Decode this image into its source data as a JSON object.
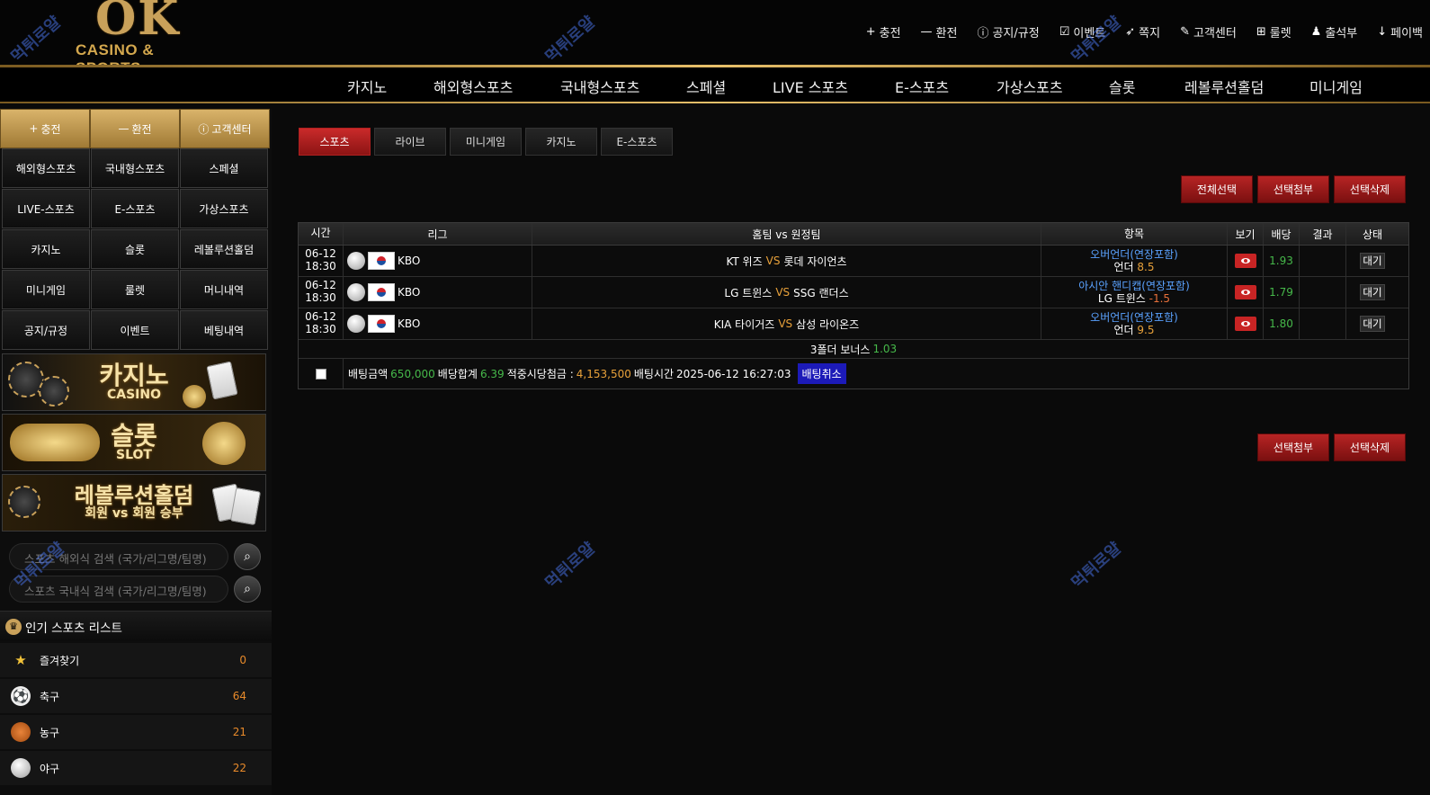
{
  "logo": {
    "main": "OK",
    "sub": "CASINO & SPORTS"
  },
  "topnav": [
    {
      "icon": "plus-icon",
      "glyph": "+",
      "label": "충전"
    },
    {
      "icon": "minus-icon",
      "glyph": "—",
      "label": "환전"
    },
    {
      "icon": "info-icon",
      "glyph": "ⓘ",
      "label": "공지/규정"
    },
    {
      "icon": "calendar-check-icon",
      "glyph": "☑",
      "label": "이벤트"
    },
    {
      "icon": "paper-plane-icon",
      "glyph": "➶",
      "label": "쪽지"
    },
    {
      "icon": "edit-icon",
      "glyph": "✎",
      "label": "고객센터"
    },
    {
      "icon": "gift-icon",
      "glyph": "⊞",
      "label": "룰렛"
    },
    {
      "icon": "stamp-icon",
      "glyph": "♟",
      "label": "출석부"
    },
    {
      "icon": "payback-icon",
      "glyph": "↓",
      "label": "페이백"
    }
  ],
  "mainnav": [
    "카지노",
    "해외형스포츠",
    "국내형스포츠",
    "스페셜",
    "LIVE 스포츠",
    "E-스포츠",
    "가상스포츠",
    "슬롯",
    "레볼루션홀덤",
    "미니게임"
  ],
  "sidebar": {
    "quick": [
      {
        "glyph": "+",
        "label": "충전"
      },
      {
        "glyph": "—",
        "label": "환전"
      },
      {
        "glyph": "ⓘ",
        "label": "고객센터"
      }
    ],
    "grid": [
      "해외형스포츠",
      "국내형스포츠",
      "스페셜",
      "LIVE-스포츠",
      "E-스포츠",
      "가상스포츠",
      "카지노",
      "슬롯",
      "레볼루션홀덤",
      "미니게임",
      "룰렛",
      "머니내역",
      "공지/규정",
      "이벤트",
      "베팅내역"
    ],
    "banners": {
      "casino": {
        "title": "카지노",
        "sub": "CASINO"
      },
      "slot": {
        "title": "슬롯",
        "sub": "SLOT"
      },
      "holdem": {
        "title": "레볼루션홀덤",
        "sub": "회원 vs 회원 승부"
      }
    },
    "search1_placeholder": "스포츠 해외식 검색 (국가/리그명/팀명)",
    "search2_placeholder": "스포츠 국내식 검색 (국가/리그명/팀명)",
    "popular_title": "인기 스포츠 리스트",
    "sports": [
      {
        "name": "즐겨찾기",
        "count": "0",
        "icon": "star-icon"
      },
      {
        "name": "축구",
        "count": "64",
        "icon": "soccer-ball-icon"
      },
      {
        "name": "농구",
        "count": "21",
        "icon": "basketball-icon"
      },
      {
        "name": "야구",
        "count": "22",
        "icon": "baseball-icon"
      }
    ]
  },
  "content": {
    "tabs": [
      "스포츠",
      "라이브",
      "미니게임",
      "카지노",
      "E-스포츠"
    ],
    "top_buttons": [
      "전체선택",
      "선택첨부",
      "선택삭제"
    ],
    "bottom_buttons": [
      "선택첨부",
      "선택삭제"
    ],
    "table": {
      "headers": [
        "시간",
        "리그",
        "홈팀 vs 원정팀",
        "항목",
        "보기",
        "배당",
        "결과",
        "상태"
      ],
      "rows": [
        {
          "date": "06-12",
          "time": "18:30",
          "league": "KBO",
          "home": "KT 위즈",
          "vs": "VS",
          "away": "롯데 자이언츠",
          "item_top": "오버언더(연장포함)",
          "item_label": "언더",
          "item_value": "8.5",
          "odds": "1.93",
          "result": "",
          "status": "대기"
        },
        {
          "date": "06-12",
          "time": "18:30",
          "league": "KBO",
          "home": "LG 트윈스",
          "vs": "VS",
          "away": "SSG 랜더스",
          "item_top": "아시안 핸디캡(연장포함)",
          "item_label": "LG 트윈스",
          "item_value": "-1.5",
          "odds": "1.79",
          "result": "",
          "status": "대기"
        },
        {
          "date": "06-12",
          "time": "18:30",
          "league": "KBO",
          "home": "KIA 타이거즈",
          "vs": "VS",
          "away": "삼성 라이온즈",
          "item_top": "오버언더(연장포함)",
          "item_label": "언더",
          "item_value": "9.5",
          "odds": "1.80",
          "result": "",
          "status": "대기"
        }
      ],
      "bonus_label": "3폴더 보너스",
      "bonus_value": "1.03",
      "summary": {
        "amount_label": "배팅금액",
        "amount": "650,000",
        "total_label": "배당합계",
        "total": "6.39",
        "payout_label": "적중시당첨금 :",
        "payout": "4,153,500",
        "time_label": "배팅시간",
        "time": "2025-06-12 16:27:03",
        "cancel": "배팅취소"
      }
    }
  },
  "watermark": "먹튀로얄"
}
